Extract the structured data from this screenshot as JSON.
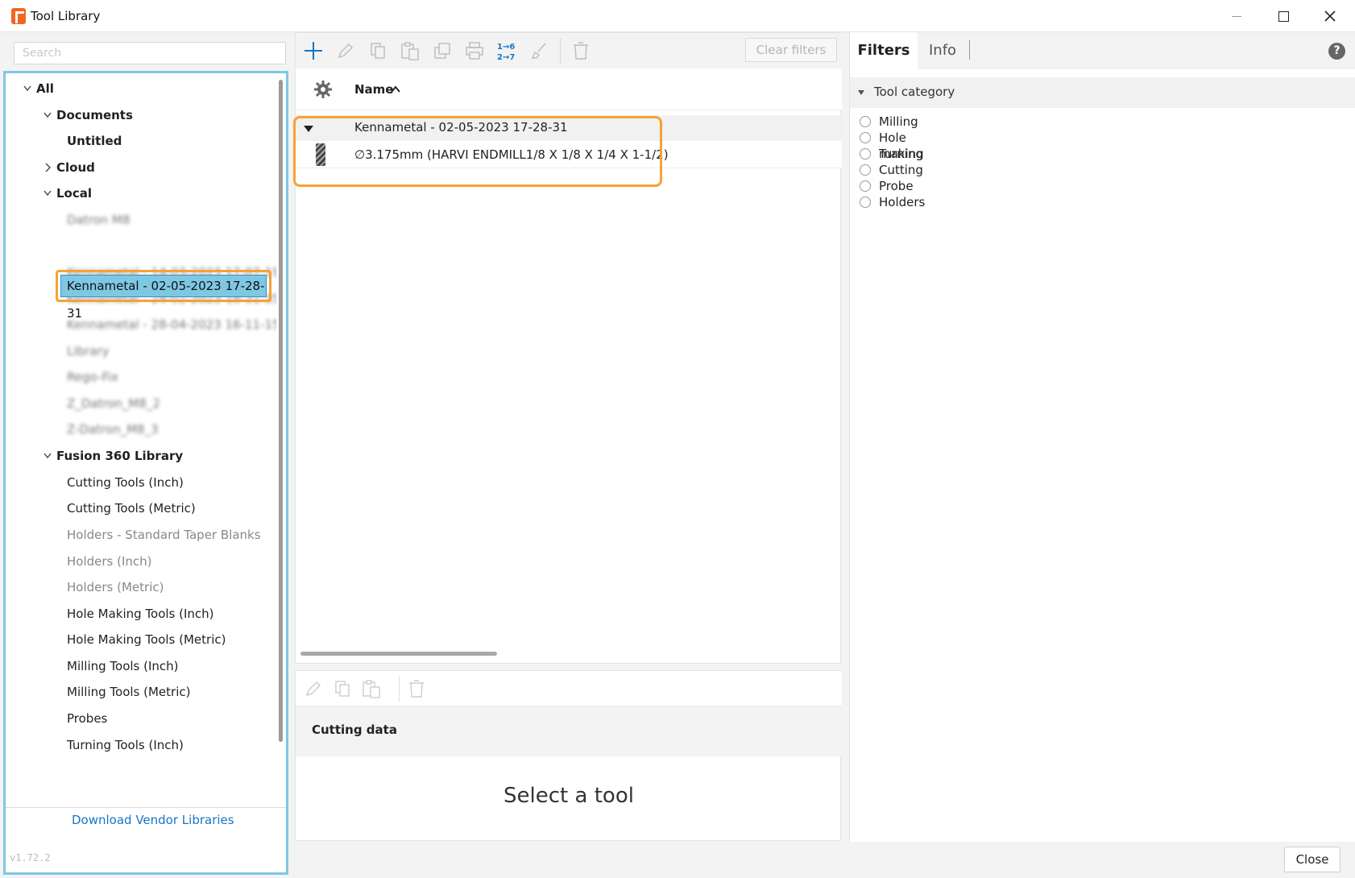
{
  "window": {
    "title": "Tool Library"
  },
  "search": {
    "placeholder": "Search"
  },
  "tree": {
    "all": "All",
    "documents": "Documents",
    "untitled": "Untitled",
    "cloud": "Cloud",
    "local": "Local",
    "local_items": [
      "Datron M8",
      "Kennametal - 02-05-2023 17-28-31",
      "Kennametal - 14-03-2023 17-07-19",
      "Kennametal - 24-02-2023 18-31-35",
      "Kennametal - 28-04-2023 16-11-15",
      "Library",
      "Rego-Fix",
      "Z_Datron_M8_2",
      "Z-Datron_M8_3"
    ],
    "fusion": "Fusion 360 Library",
    "fusion_items": [
      "Cutting Tools (Inch)",
      "Cutting Tools (Metric)",
      "Holders - Standard Taper Blanks",
      "Holders (Inch)",
      "Holders (Metric)",
      "Hole Making Tools (Inch)",
      "Hole Making Tools (Metric)",
      "Milling Tools (Inch)",
      "Milling Tools (Metric)",
      "Probes",
      "Turning Tools (Inch)"
    ],
    "download_link": "Download Vendor Libraries"
  },
  "version": "v1.72.2",
  "toolbar": {
    "clear_filters": "Clear filters"
  },
  "list": {
    "column_name": "Name",
    "group": "Kennametal - 02-05-2023 17-28-31",
    "tool": "∅3.175mm (HARVI ENDMILL1/8 X 1/8 X 1/4 X 1-1/2)"
  },
  "detail": {
    "cutting_data": "Cutting data",
    "empty_message": "Select a tool"
  },
  "right": {
    "tab_filters": "Filters",
    "tab_info": "Info",
    "category_title": "Tool category",
    "categories": [
      "Milling",
      "Hole making",
      "Turning",
      "Cutting",
      "Probe",
      "Holders"
    ]
  },
  "footer": {
    "close_label": "Close"
  },
  "colors": {
    "accent_blue": "#7ec8e3",
    "highlight_orange": "#f7a234",
    "link_blue": "#1a73c8"
  }
}
